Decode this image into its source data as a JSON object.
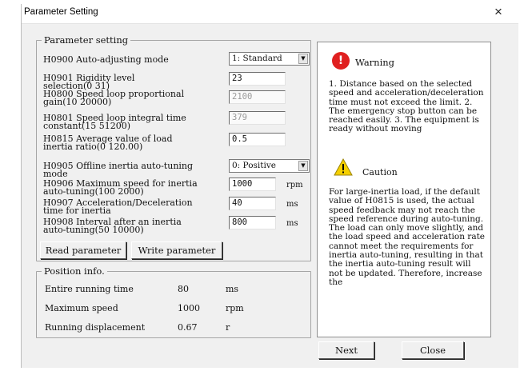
{
  "window": {
    "title": "Parameter Setting",
    "close_glyph": "×"
  },
  "parameter_group": {
    "legend": "Parameter setting",
    "rows": [
      {
        "code": "H0900 Auto-adjusting mode",
        "value": "1: Standard"
      },
      {
        "line1": "H0901 Rigidity level",
        "line2": "selection(0 31)",
        "value": "23"
      },
      {
        "line1": "H0800 Speed loop proportional",
        "line2": "gain(10 20000)",
        "value": "2100"
      },
      {
        "line1": "H0801 Speed loop integral time",
        "line2": "constant(15 51200)",
        "value": "379"
      },
      {
        "line1": "H0815 Average value of load",
        "line2": "inertia ratio(0 120.00)",
        "value": "0.5"
      },
      {
        "line1": "H0905 Offline inertia auto-tuning",
        "line2": "mode",
        "value": "0: Positive"
      },
      {
        "line1": "H0906 Maximum speed for inertia",
        "line2": "auto-tuning(100 2000)",
        "value": "1000",
        "unit": "rpm"
      },
      {
        "line1": "H0907 Acceleration/Deceleration",
        "line2": "time for inertia",
        "value": "40",
        "unit": "ms"
      },
      {
        "line1": "H0908 Interval after an inertia",
        "line2": "auto-tuning(50 10000)",
        "value": "800",
        "unit": "ms"
      }
    ],
    "read_button": "Read parameter",
    "write_button": "Write parameter"
  },
  "position_group": {
    "legend": "Position info.",
    "rows": [
      {
        "label": "Entire running time",
        "value": "80",
        "unit": "ms"
      },
      {
        "label": "Maximum speed",
        "value": "1000",
        "unit": "rpm"
      },
      {
        "label": "Running displacement",
        "value": "0.67",
        "unit": "r"
      }
    ]
  },
  "warning": {
    "icon": "error-icon",
    "title": "Warning",
    "text": "1. Distance based on the selected speed and acceleration/deceleration time must not exceed the limit. 2. The emergency stop button can be reached easily. 3. The equipment is ready without moving"
  },
  "caution": {
    "icon": "warning-triangle-icon",
    "title": "Caution",
    "text": "For large-inertia load, if the default value of H0815 is used, the actual speed feedback may not reach the speed reference during auto-tuning. The load can only move slightly, and the load speed and acceleration rate cannot meet the requirements for inertia auto-tuning, resulting in that the inertia auto-tuning result will not be updated. Therefore, increase the"
  },
  "footer": {
    "next_button": "Next",
    "close_button": "Close"
  }
}
